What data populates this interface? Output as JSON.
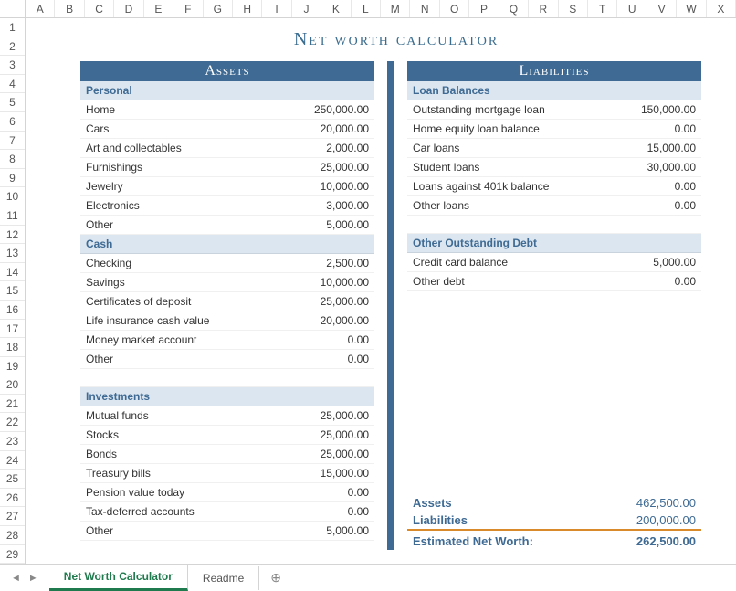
{
  "columns": [
    "A",
    "B",
    "C",
    "D",
    "E",
    "F",
    "G",
    "H",
    "I",
    "J",
    "K",
    "L",
    "M",
    "N",
    "O",
    "P",
    "Q",
    "R",
    "S",
    "T",
    "U",
    "V",
    "W",
    "X"
  ],
  "rows": [
    "1",
    "2",
    "3",
    "4",
    "5",
    "6",
    "7",
    "8",
    "9",
    "10",
    "11",
    "12",
    "13",
    "14",
    "15",
    "16",
    "17",
    "18",
    "19",
    "20",
    "21",
    "22",
    "23",
    "24",
    "25",
    "26",
    "27",
    "28",
    "29"
  ],
  "title": "Net worth calculator",
  "assets_header": "Assets",
  "liabilities_header": "Liabilities",
  "assets": {
    "personal": {
      "label": "Personal",
      "items": [
        {
          "label": "Home",
          "value": "250,000.00"
        },
        {
          "label": "Cars",
          "value": "20,000.00"
        },
        {
          "label": "Art and collectables",
          "value": "2,000.00"
        },
        {
          "label": "Furnishings",
          "value": "25,000.00"
        },
        {
          "label": "Jewelry",
          "value": "10,000.00"
        },
        {
          "label": "Electronics",
          "value": "3,000.00"
        },
        {
          "label": "Other",
          "value": "5,000.00"
        }
      ]
    },
    "cash": {
      "label": "Cash",
      "items": [
        {
          "label": "Checking",
          "value": "2,500.00"
        },
        {
          "label": "Savings",
          "value": "10,000.00"
        },
        {
          "label": "Certificates of deposit",
          "value": "25,000.00"
        },
        {
          "label": "Life insurance cash value",
          "value": "20,000.00"
        },
        {
          "label": "Money market account",
          "value": "0.00"
        },
        {
          "label": "Other",
          "value": "0.00"
        }
      ]
    },
    "investments": {
      "label": "Investments",
      "items": [
        {
          "label": "Mutual funds",
          "value": "25,000.00"
        },
        {
          "label": "Stocks",
          "value": "25,000.00"
        },
        {
          "label": "Bonds",
          "value": "25,000.00"
        },
        {
          "label": "Treasury bills",
          "value": "15,000.00"
        },
        {
          "label": "Pension value today",
          "value": "0.00"
        },
        {
          "label": "Tax-deferred accounts",
          "value": "0.00"
        },
        {
          "label": "Other",
          "value": "5,000.00"
        }
      ]
    }
  },
  "liabilities": {
    "loans": {
      "label": "Loan Balances",
      "items": [
        {
          "label": "Outstanding mortgage loan",
          "value": "150,000.00"
        },
        {
          "label": "Home equity loan balance",
          "value": "0.00"
        },
        {
          "label": "Car loans",
          "value": "15,000.00"
        },
        {
          "label": "Student loans",
          "value": "30,000.00"
        },
        {
          "label": "Loans against 401k balance",
          "value": "0.00"
        },
        {
          "label": "Other loans",
          "value": "0.00"
        }
      ]
    },
    "other_debt": {
      "label": "Other Outstanding Debt",
      "items": [
        {
          "label": "Credit card balance",
          "value": "5,000.00"
        },
        {
          "label": "Other debt",
          "value": "0.00"
        }
      ]
    }
  },
  "summary": {
    "assets": {
      "label": "Assets",
      "value": "462,500.00"
    },
    "liabilities": {
      "label": "Liabilities",
      "value": "200,000.00"
    },
    "networth": {
      "label": "Estimated Net Worth:",
      "value": "262,500.00"
    }
  },
  "tabs": {
    "active": "Net Worth Calculator",
    "other": "Readme"
  },
  "chart_data": {
    "type": "table",
    "title": "Net worth calculator",
    "assets": [
      {
        "category": "Personal",
        "item": "Home",
        "value": 250000
      },
      {
        "category": "Personal",
        "item": "Cars",
        "value": 20000
      },
      {
        "category": "Personal",
        "item": "Art and collectables",
        "value": 2000
      },
      {
        "category": "Personal",
        "item": "Furnishings",
        "value": 25000
      },
      {
        "category": "Personal",
        "item": "Jewelry",
        "value": 10000
      },
      {
        "category": "Personal",
        "item": "Electronics",
        "value": 3000
      },
      {
        "category": "Personal",
        "item": "Other",
        "value": 5000
      },
      {
        "category": "Cash",
        "item": "Checking",
        "value": 2500
      },
      {
        "category": "Cash",
        "item": "Savings",
        "value": 10000
      },
      {
        "category": "Cash",
        "item": "Certificates of deposit",
        "value": 25000
      },
      {
        "category": "Cash",
        "item": "Life insurance cash value",
        "value": 20000
      },
      {
        "category": "Cash",
        "item": "Money market account",
        "value": 0
      },
      {
        "category": "Cash",
        "item": "Other",
        "value": 0
      },
      {
        "category": "Investments",
        "item": "Mutual funds",
        "value": 25000
      },
      {
        "category": "Investments",
        "item": "Stocks",
        "value": 25000
      },
      {
        "category": "Investments",
        "item": "Bonds",
        "value": 25000
      },
      {
        "category": "Investments",
        "item": "Treasury bills",
        "value": 15000
      },
      {
        "category": "Investments",
        "item": "Pension value today",
        "value": 0
      },
      {
        "category": "Investments",
        "item": "Tax-deferred accounts",
        "value": 0
      },
      {
        "category": "Investments",
        "item": "Other",
        "value": 5000
      }
    ],
    "liabilities": [
      {
        "category": "Loan Balances",
        "item": "Outstanding mortgage loan",
        "value": 150000
      },
      {
        "category": "Loan Balances",
        "item": "Home equity loan balance",
        "value": 0
      },
      {
        "category": "Loan Balances",
        "item": "Car loans",
        "value": 15000
      },
      {
        "category": "Loan Balances",
        "item": "Student loans",
        "value": 30000
      },
      {
        "category": "Loan Balances",
        "item": "Loans against 401k balance",
        "value": 0
      },
      {
        "category": "Loan Balances",
        "item": "Other loans",
        "value": 0
      },
      {
        "category": "Other Outstanding Debt",
        "item": "Credit card balance",
        "value": 5000
      },
      {
        "category": "Other Outstanding Debt",
        "item": "Other debt",
        "value": 0
      }
    ],
    "totals": {
      "assets": 462500,
      "liabilities": 200000,
      "net_worth": 262500
    }
  }
}
